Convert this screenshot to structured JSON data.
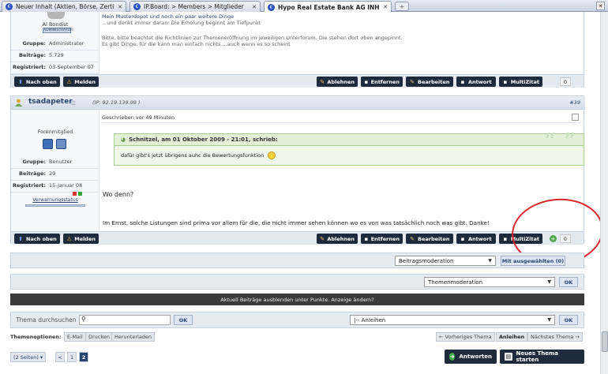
{
  "browser": {
    "tabs": [
      {
        "title": "Neuer Inhalt (Aktien, Börse, Zertifik...",
        "active": false
      },
      {
        "title": "IP.Board: > Members > Mitglieder",
        "active": false
      },
      {
        "title": "Hypo Real Estate Bank AG INH.SC...",
        "active": true
      }
    ],
    "close_symbol": "✕",
    "new_tab_symbol": "+",
    "favicon_letter": "€"
  },
  "post1": {
    "user_title": "Al Bondist",
    "user_banner": "ADMINISTRATOR",
    "fields": [
      {
        "key": "Gruppe:",
        "value": "Administrator"
      },
      {
        "key": "Beiträge:",
        "value": "5.729"
      },
      {
        "key": "Registriert:",
        "value": "03-September 07"
      }
    ],
    "sig_line1": "Mein Musterdepot und noch ein paar weitere Dinge",
    "sig_line2": "...und denkt immer daran: Die Erholung beginnt am Tiefpunkt",
    "sig_line3": "Bitte, bitte beachtet die Richtlinien zur Themeneröffnung im jeweiligen Unterforum. Die stehen dort oben angepinnt.",
    "sig_line4": "Es gibt Dinge, für die kann man einfach nichts....auch wenn es so scheint",
    "count": "0"
  },
  "actions": {
    "top": "Nach oben",
    "report": "Melden",
    "reject": "Ablehnen",
    "remove": "Entfernen",
    "edit": "Bearbeiten",
    "reply": "Antwort",
    "multiquote": "MultiZitat"
  },
  "post2": {
    "username": "tsadapeter",
    "ip": "(IP: 92.19.139.99 )",
    "post_number": "#39",
    "rank": "Forenmitglied",
    "fields": [
      {
        "key": "Gruppe:",
        "value": "Benutzer"
      },
      {
        "key": "Beiträge:",
        "value": "29"
      },
      {
        "key": "Registriert:",
        "value": "15-Januar 08"
      }
    ],
    "warn_label": "Verwarnungsstatus",
    "written": "Geschrieben vor 49 Minuten",
    "quote_header": "Schnitzel, am 01 Oktober 2009 - 21:01, schrieb:",
    "quote_text": "dafür gibt's jetzt übrigens auhc die Bewertungsfunktion",
    "quote_mark": "“ ”",
    "text1": "Wo denn?",
    "text2": "Im Ernst, solche Listungen sind prima vor allem für die, die nicht immer sehen können wo es von was tatsächlich noch was gibt. Danke!",
    "count": "0"
  },
  "moderation": {
    "post_mod_select": "Beitragsmoderation",
    "post_mod_button": "Mit ausgewählten (0)",
    "topic_mod_select": "Themenmoderation",
    "ok": "OK"
  },
  "notice": "Aktuell Beiträge ausblenden unter Punkte. Anzeige ändern?",
  "search": {
    "placeholder": "Thema durchsuchen",
    "ok": "OK",
    "forum_select": "|-- Anleihen",
    "forum_ok": "OK"
  },
  "topic_options": {
    "label": "Themenoptionen:",
    "items": [
      "E-Mail",
      "Drucken",
      "Herunterladen"
    ]
  },
  "topic_nav": {
    "prev": "← Vorheriges Thema",
    "current": "Anleihen",
    "next": "Nächstes Thema →"
  },
  "pagination": {
    "pages": "(2 Seiten)",
    "dropdown": "▾",
    "prev": "<",
    "p1": "1",
    "p2": "2"
  },
  "bottom": {
    "answer": "Antworten",
    "new_topic": "Neues Thema starten"
  },
  "colors": {
    "accent": "#2a4470",
    "dark_button": "#1e2b3d",
    "highlight": "#d8262c"
  }
}
